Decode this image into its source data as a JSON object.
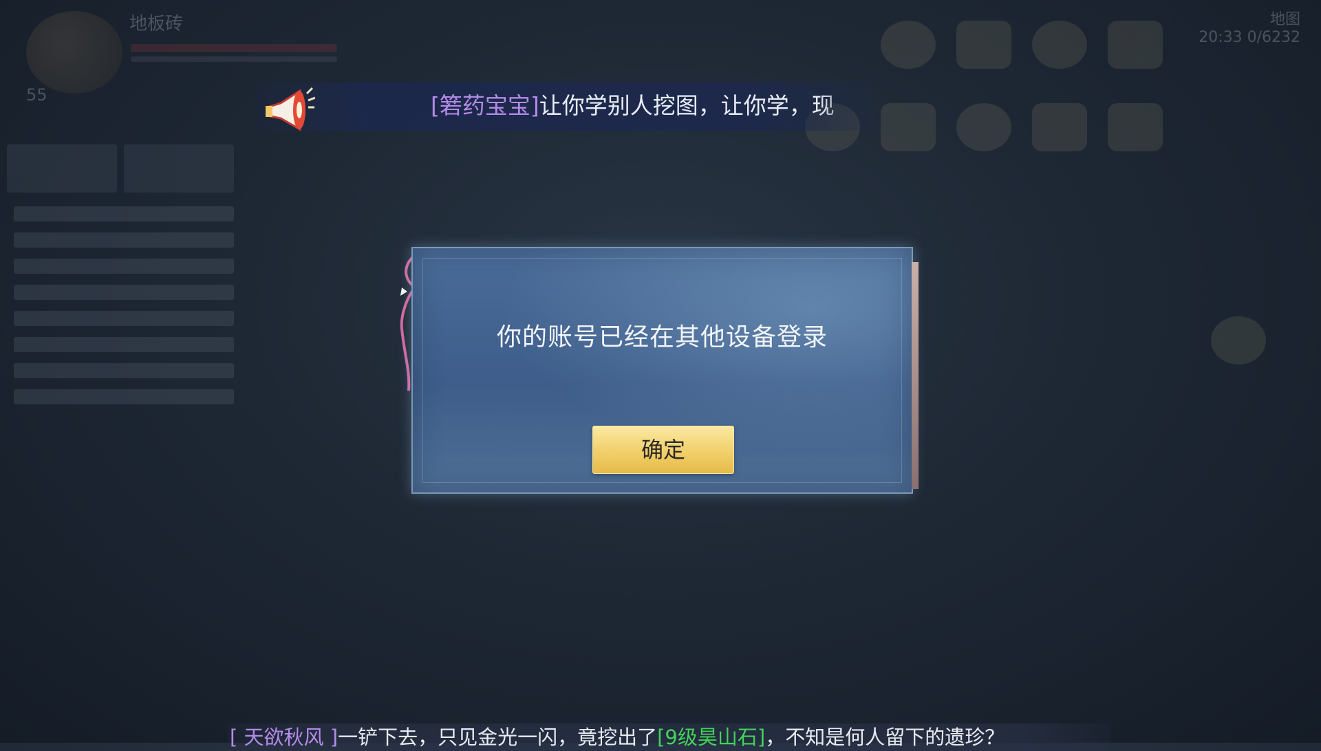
{
  "hud": {
    "player_name": "地板砖",
    "level": "55",
    "map_label": "地图",
    "time_text": "20:33 0/6232"
  },
  "broadcast": {
    "sender": "[箬药宝宝]",
    "message": "让你学别人挖图，让你学，现"
  },
  "dialog": {
    "message": "你的账号已经在其他设备登录",
    "confirm_label": "确定"
  },
  "system_message": {
    "player": "[ 天欲秋风 ]",
    "text_before": "一铲下去，只见金光一闪，竟挖出了",
    "item": "[9级昊山石]",
    "text_after": "，不知是何人留下的遗珍？"
  },
  "colors": {
    "player_name": "#b48be8",
    "item_green": "#43d35a",
    "confirm_button": "#f1cf6a",
    "dialog_bg": "#3e5d8a"
  }
}
